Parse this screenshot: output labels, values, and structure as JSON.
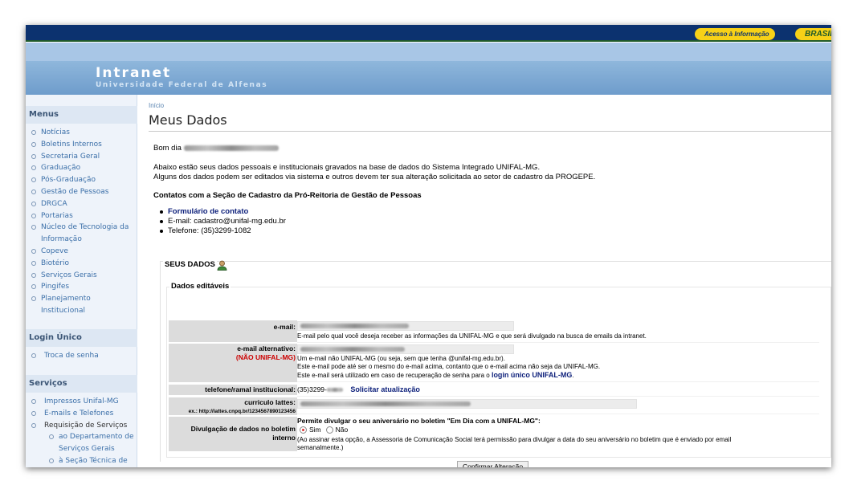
{
  "gov_bar": {
    "acesso_label": "Acesso à Informação",
    "brasil_label": "BRASIL"
  },
  "header": {
    "title": "Intranet",
    "subtitle": "Universidade Federal de Alfenas"
  },
  "sidebar": {
    "menus_heading": "Menus",
    "menus": [
      "Notícias",
      "Boletins Internos",
      "Secretaria Geral",
      "Graduação",
      "Pós-Graduação",
      "Gestão de Pessoas",
      "DRGCA",
      "Portarias",
      "Núcleo de Tecnologia da",
      "Informação",
      "Copeve",
      "Biotério",
      "Serviços Gerais",
      "Pingifes",
      "Planejamento",
      "Institucional"
    ],
    "login_heading": "Login Único",
    "login_items": [
      "Troca de senha"
    ],
    "servicos_heading": "Serviços",
    "servicos_items": [
      "Impressos Unifal-MG",
      "E-mails e Telefones",
      "Requisição de Serviços"
    ],
    "servicos_sub": [
      "ao Departamento de",
      "Serviços Gerais",
      "à Seção Técnica de"
    ]
  },
  "main": {
    "breadcrumb": "Início",
    "title": "Meus Dados",
    "greeting": "Bom dia",
    "intro1": "Abaixo estão seus dados pessoais e institucionais gravados na base de dados do Sistema Integrado UNIFAL-MG.",
    "intro2": "Alguns dos dados podem ser editados via sistema e outros devem ter sua alteração solicitada ao setor de cadastro da PROGEPE.",
    "contacts_heading": "Contatos com a Seção de Cadastro da Pró-Reitoria de Gestão de Pessoas",
    "contact_form": "Formulário de contato",
    "contact_email": "E-mail: cadastro@unifal-mg.edu.br",
    "contact_phone": "Telefone: (35)3299-1082",
    "seus_dados": "SEUS DADOS",
    "editaveis": "Dados editáveis",
    "email_label": "e-mail:",
    "email_desc": "E-mail pelo qual você deseja receber as informações da UNIFAL-MG e que será divulgado na busca de emails da intranet.",
    "alt_label": "e-mail alternativo:",
    "alt_note": "(NÃO UNIFAL-MG)",
    "alt_desc1": "Um e-mail não UNIFAL-MG (ou seja, sem que tenha @unifal-mg.edu.br).",
    "alt_desc2": "Este e-mail pode até ser o mesmo do e-mail acima, contanto que o e-mail acima não seja da UNIFAL-MG.",
    "alt_desc3": "Este e-mail será utilizado em caso de recuperação de senha para o",
    "alt_link": "login único UNIFAL-MG",
    "alt_end": ".",
    "phone_label": "telefone/ramal institucional:",
    "phone_value": "(35)3299-",
    "phone_link": "Solicitar atualização",
    "lattes_label": "curriculo lattes:",
    "lattes_example": "ex.: http://lattes.cnpq.br/1234567890123456",
    "div_label1": "Divulgação de dados no boletim",
    "div_label2": "interno",
    "div_question": "Permite divulgar o seu aniversário no boletim \"Em Dia com a UNIFAL-MG\":",
    "opt_yes": "Sim",
    "opt_no": "Não",
    "div_desc1": "(Ao assinar esta opção, a Assessoria de Comunicação Social terá permissão para divulgar a data do seu aniversário no boletim que é enviado por email",
    "div_desc2": "semanalmente.)",
    "confirm": "Confirmar Alteração"
  }
}
